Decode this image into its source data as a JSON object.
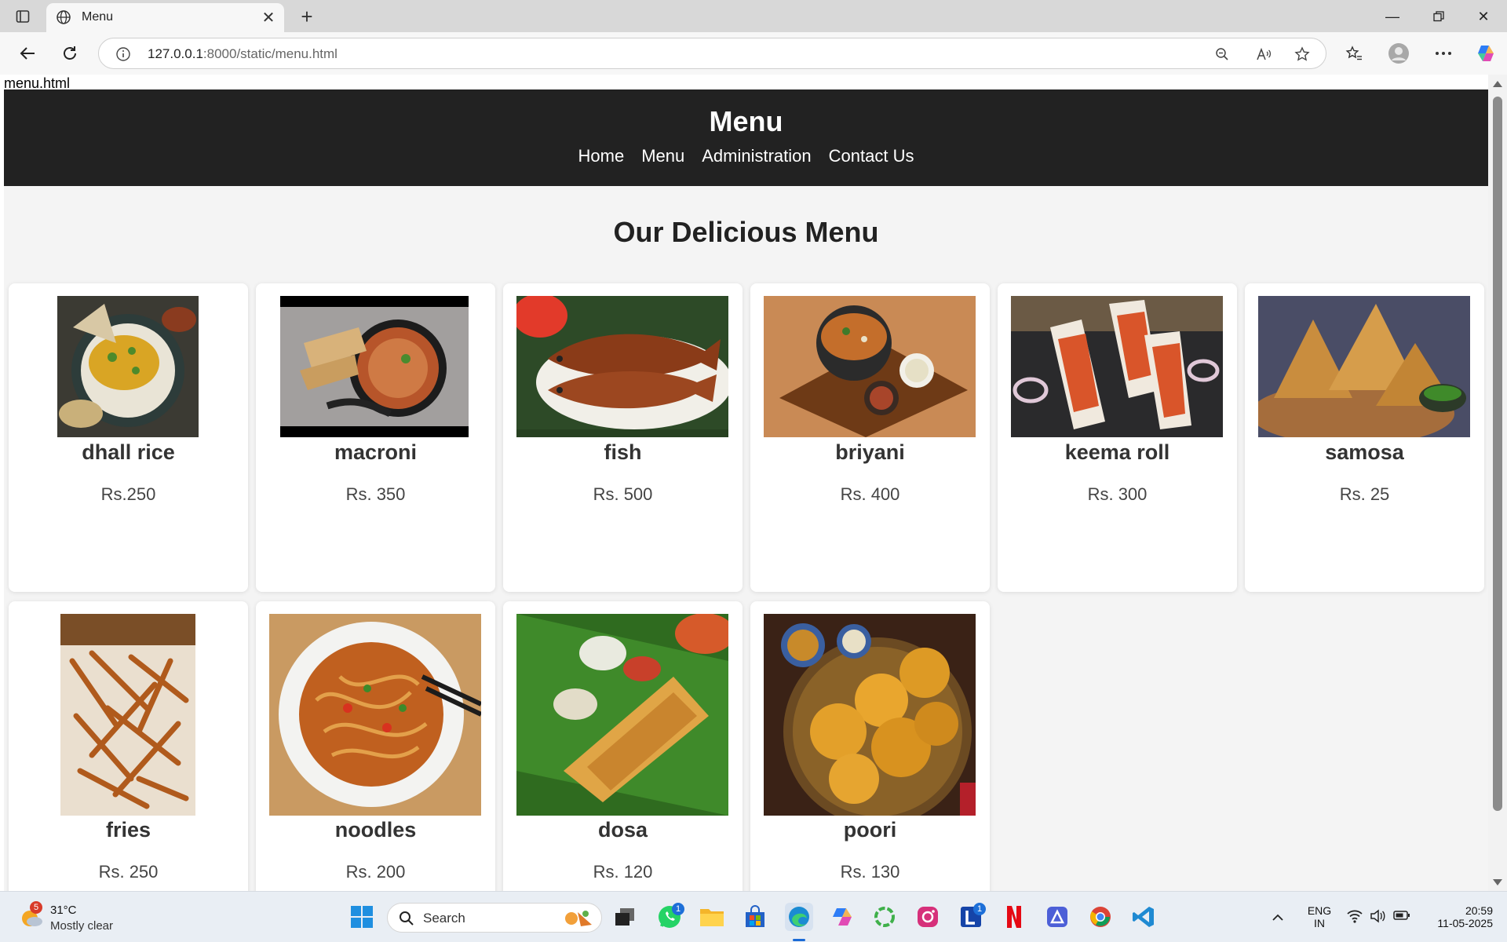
{
  "browser": {
    "tab_title": "Menu",
    "url_host": "127.0.0.1",
    "url_rest": ":8000/static/menu.html"
  },
  "page": {
    "file_label": "menu.html",
    "header_title": "Menu",
    "nav": [
      "Home",
      "Menu",
      "Administration",
      "Contact Us"
    ],
    "section_title": "Our Delicious Menu"
  },
  "menu_items": [
    {
      "name": "dhall rice",
      "price": "Rs.250"
    },
    {
      "name": "macroni",
      "price": "Rs. 350"
    },
    {
      "name": "fish",
      "price": "Rs. 500"
    },
    {
      "name": "briyani",
      "price": "Rs. 400"
    },
    {
      "name": "keema roll",
      "price": "Rs. 300"
    },
    {
      "name": "samosa",
      "price": "Rs. 25"
    },
    {
      "name": "fries",
      "price": "Rs. 250"
    },
    {
      "name": "noodles",
      "price": "Rs. 200"
    },
    {
      "name": "dosa",
      "price": "Rs. 120"
    },
    {
      "name": "poori",
      "price": "Rs. 130"
    }
  ],
  "taskbar": {
    "weather_temp": "31°C",
    "weather_desc": "Mostly clear",
    "weather_badge": "5",
    "search_placeholder": "Search",
    "whatsapp_badge": "1",
    "l_badge": "1",
    "lang_1": "ENG",
    "lang_2": "IN",
    "time": "20:59",
    "date": "11-05-2025"
  },
  "colors": {
    "header_bg": "#222222",
    "page_bg": "#f4f4f4",
    "card_bg": "#ffffff"
  }
}
